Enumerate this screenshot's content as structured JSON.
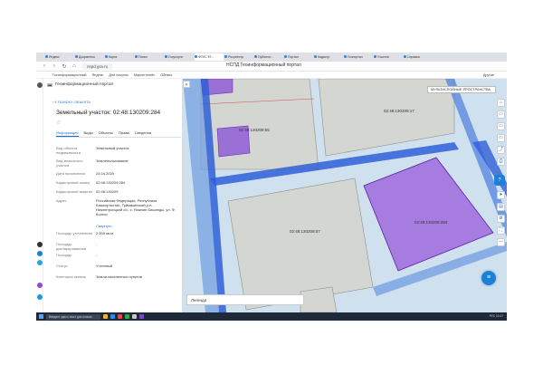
{
  "browser": {
    "tabs": [
      "Яндекс",
      "Документы",
      "Карта",
      "Поиск",
      "Госуслуги",
      "ФГИС ЕГ...",
      "Росреестр",
      "Публичн...",
      "Портал",
      "Кадастр",
      "Геопортал",
      "Участки",
      "Справка"
    ],
    "active_tab_index": 5,
    "url": "nspd.gov.ru",
    "page_title": "НСПД Геоинформационный портал",
    "bookmarks": [
      "Госинформационный",
      "Яндекс",
      "Для покупок",
      "Маркетплейс",
      "Облако"
    ],
    "bookmarks_right": "Другие"
  },
  "panel": {
    "portal_name": "Геоинформационный портал",
    "back_link": "К ПОИСКУ ОБЪЕКТА",
    "object_title": "Земельный участок: 02:48:130209:284",
    "star": "☆",
    "tabs": [
      "Информация",
      "Виды",
      "Объекты",
      "Права",
      "Сведения"
    ],
    "rows": [
      {
        "k": "Вид объекта недвижимости",
        "v": "Земельный участок"
      },
      {
        "k": "Вид земельного участка",
        "v": "Землепользование"
      },
      {
        "k": "Дата присвоения",
        "v": "24.04.2020"
      },
      {
        "k": "Кадастровый номер",
        "v": "02:48:130209:284"
      },
      {
        "k": "Кадастровый квартал",
        "v": "02:48:130209"
      },
      {
        "k": "Адрес",
        "v": "Российская Федерация, Республика Башкортостан, Туймазинский р-н, Нижнетроицкий с/с, с. Нижние Бишинды, ул. Ф. Колхоз"
      },
      {
        "k": "Площадь уточненная",
        "v": "2 000 кв.м"
      },
      {
        "k": "Площадь декларированная",
        "v": "-"
      },
      {
        "k": "Площадь",
        "v": "-"
      },
      {
        "k": "Статус",
        "v": "Учтенный"
      },
      {
        "k": "Категория земель",
        "v": "Земли населенных пунктов"
      }
    ],
    "expand_label": "Свернуть"
  },
  "map": {
    "collapse": "«",
    "layer_select": "МУЛЬТИСЛОЙНЫЕ ПРОСТРАНСТВА",
    "legend": "Легенда",
    "labels": [
      "02:48:130209:55",
      "02:48:130209:17",
      "02:48:130209:57",
      "02:48:130209:284"
    ],
    "tools": [
      "⌂",
      "▭",
      "▭",
      "▭",
      "⤴",
      "⎙",
      "◈",
      "➤",
      "▤",
      "⚙",
      "⛶",
      "—"
    ],
    "help": "?",
    "chat": "≡",
    "colors": {
      "parcel_fill": "#9a6fd6",
      "parcel_border": "#6a2fb8",
      "road": "#3a6fd8",
      "bg": "#cfe1ee"
    }
  },
  "taskbar": {
    "search_placeholder": "Введите здесь текст для поиска",
    "tray": "РУС 10:17"
  }
}
